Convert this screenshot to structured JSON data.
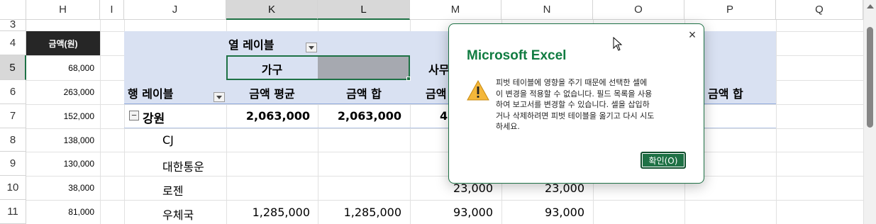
{
  "columns": [
    "H",
    "I",
    "J",
    "K",
    "L",
    "M",
    "N",
    "O",
    "P",
    "Q"
  ],
  "rows": [
    "3",
    "4",
    "5",
    "6",
    "7",
    "8",
    "9",
    "10",
    "11"
  ],
  "h_column": {
    "header": "금액(원)",
    "values": [
      "68,000",
      "263,000",
      "152,000",
      "138,000",
      "130,000",
      "38,000",
      "81,000"
    ]
  },
  "pivot": {
    "col_label": "열 레이블",
    "group_gagu": "가구",
    "group_samu": "사무",
    "row_label": "행 레이블",
    "avg_header": "금액 평균",
    "sum_header": "금액 합",
    "m_header_partial": "금액",
    "p_header": "금액 합",
    "expand_symbol": "−",
    "region": "강원",
    "region_avg": "2,063,000",
    "region_sum": "2,063,000",
    "region_m_partial": "4",
    "items": [
      {
        "name": "CJ",
        "k": "",
        "l": "",
        "m": "",
        "n": ""
      },
      {
        "name": "대한통운",
        "k": "",
        "l": "",
        "m": "",
        "n": ""
      },
      {
        "name": "로젠",
        "k": "",
        "l": "",
        "m": "23,000",
        "n": "23,000"
      },
      {
        "name": "우체국",
        "k": "1,285,000",
        "l": "1,285,000",
        "m": "93,000",
        "n": "93,000"
      }
    ]
  },
  "dialog": {
    "title": "Microsoft Excel",
    "message": "피벗 테이블에 영향을 주기 때문에 선택한 셀에\n이 변경을 적용할 수 없습니다. 필드 목록을 사용\n하여 보고서를 변경할 수 있습니다. 셀을 삽입하\n거나 삭제하려면 피벗 테이블을 옮기고 다시 시도\n하세요.",
    "ok_button": "확인(O)",
    "close_glyph": "×",
    "icon": "warning-icon",
    "accent_color": "#1e7145",
    "title_color": "#107c41"
  }
}
